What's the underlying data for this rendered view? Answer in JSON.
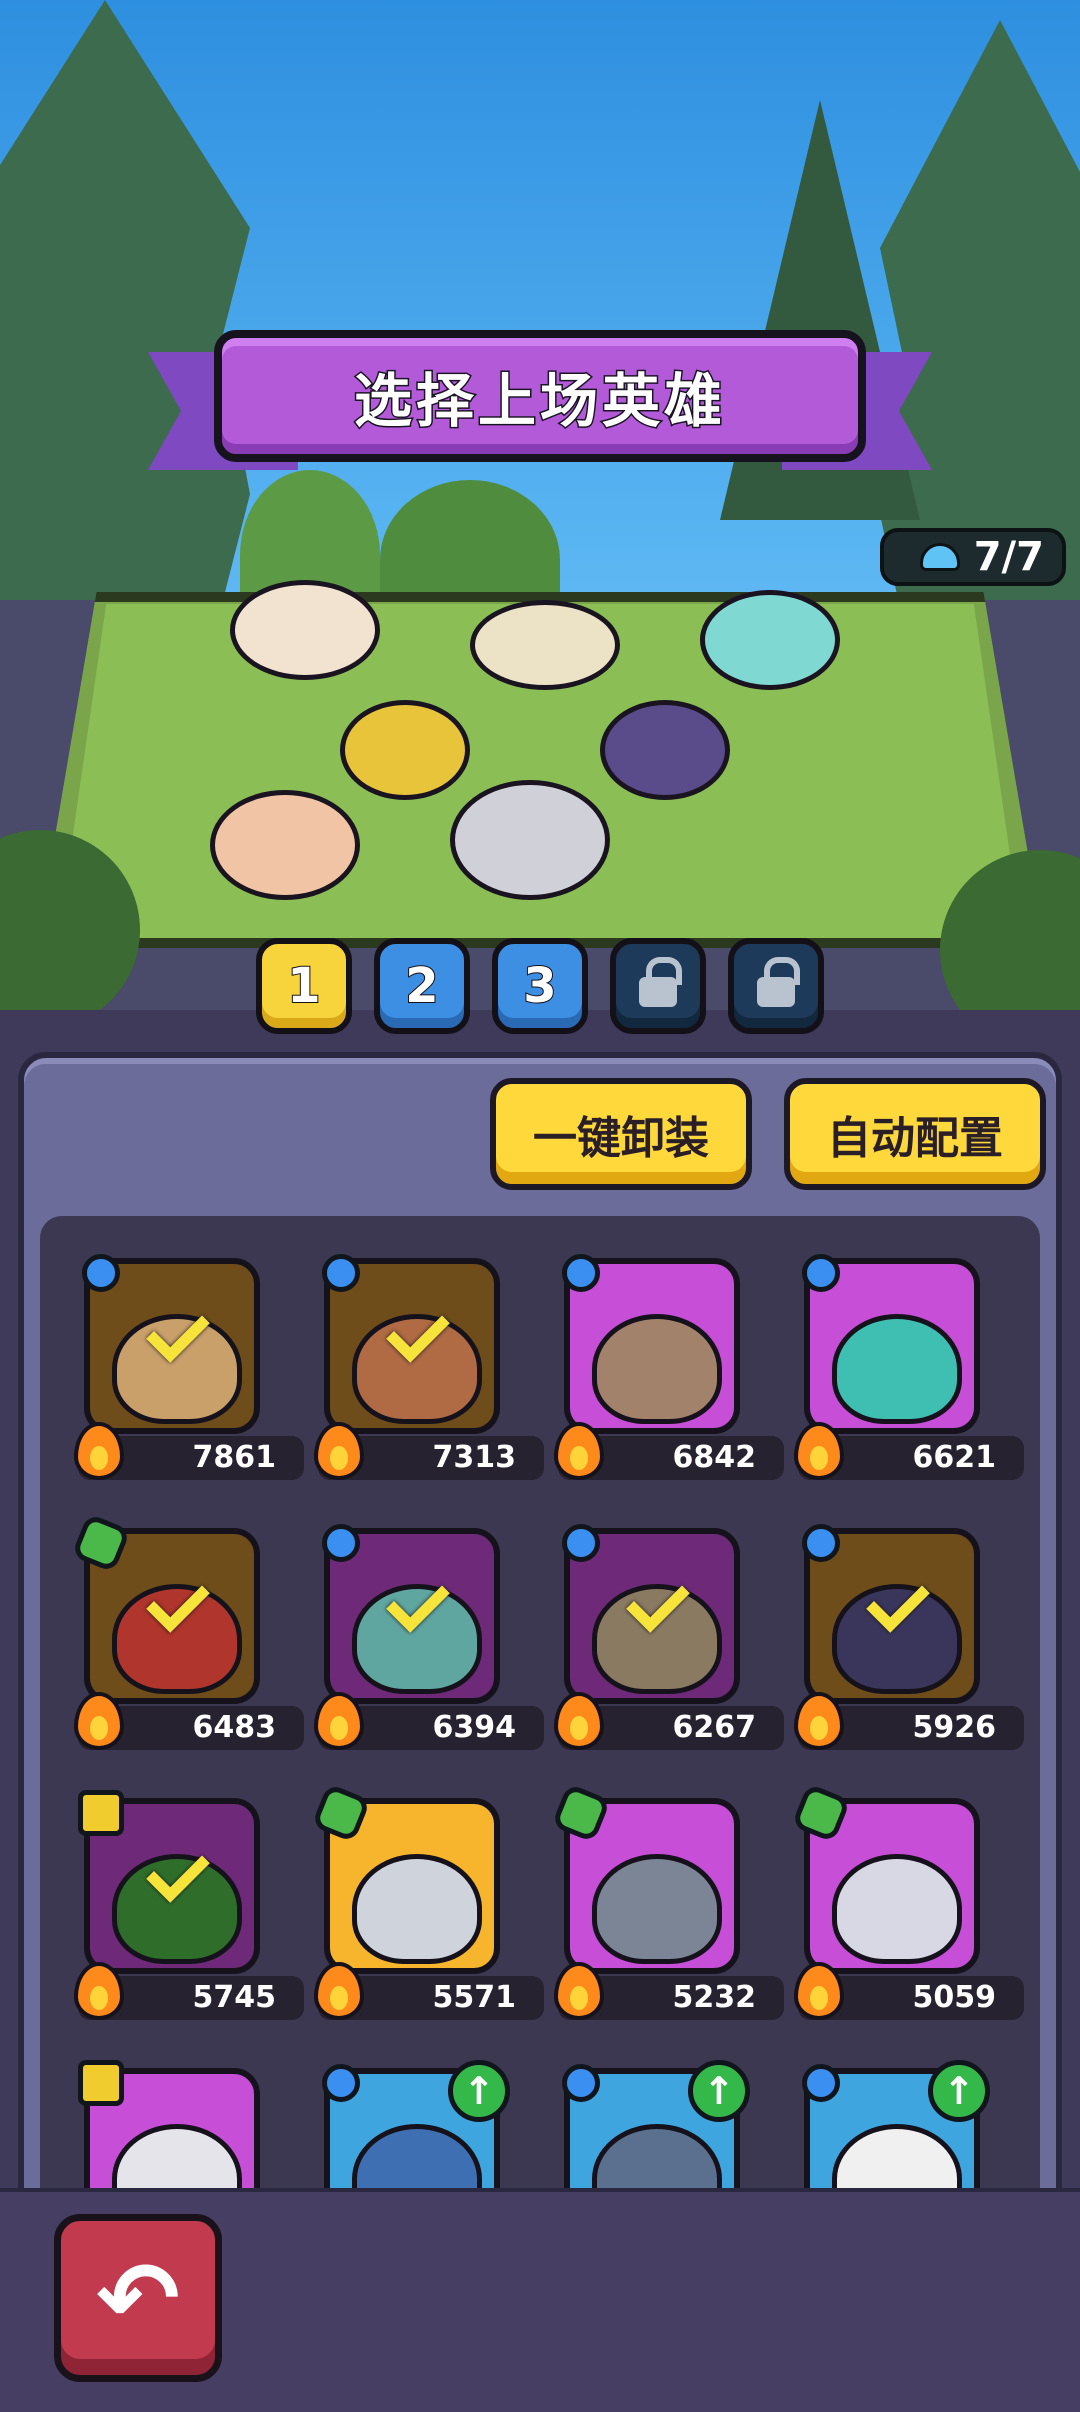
{
  "header": {
    "title": "选择上场英雄"
  },
  "capacity": {
    "value": "7/7"
  },
  "teams": [
    {
      "label": "1",
      "state": "active"
    },
    {
      "label": "2",
      "state": "normal"
    },
    {
      "label": "3",
      "state": "normal"
    },
    {
      "label": "",
      "state": "locked"
    },
    {
      "label": "",
      "state": "locked"
    }
  ],
  "actions": {
    "unequip_all": "一键卸装",
    "auto_config": "自动配置"
  },
  "heroes": [
    {
      "power": "7861",
      "badge": "blue",
      "frame": "gold",
      "selected": true
    },
    {
      "power": "7313",
      "badge": "blue",
      "frame": "gold",
      "selected": true
    },
    {
      "power": "6842",
      "badge": "blue",
      "frame": "purple",
      "selected": false
    },
    {
      "power": "6621",
      "badge": "blue",
      "frame": "purple",
      "selected": false
    },
    {
      "power": "6483",
      "badge": "green",
      "frame": "gold",
      "selected": true
    },
    {
      "power": "6394",
      "badge": "blue",
      "frame": "purple",
      "selected": true
    },
    {
      "power": "6267",
      "badge": "blue",
      "frame": "purple",
      "selected": true
    },
    {
      "power": "5926",
      "badge": "blue",
      "frame": "gold",
      "selected": true
    },
    {
      "power": "5745",
      "badge": "yellow",
      "frame": "purple",
      "selected": true
    },
    {
      "power": "5571",
      "badge": "green",
      "frame": "yellow",
      "selected": false
    },
    {
      "power": "5232",
      "badge": "green",
      "frame": "purple",
      "selected": false
    },
    {
      "power": "5059",
      "badge": "green",
      "frame": "purple",
      "selected": false
    },
    {
      "power": "",
      "badge": "yellow",
      "frame": "purple",
      "selected": false,
      "upgrade": false
    },
    {
      "power": "",
      "badge": "blue",
      "frame": "blue",
      "selected": false,
      "upgrade": true
    },
    {
      "power": "",
      "badge": "blue",
      "frame": "blue",
      "selected": false,
      "upgrade": true
    },
    {
      "power": "",
      "badge": "blue",
      "frame": "blue",
      "selected": false,
      "upgrade": true
    }
  ],
  "footer": {
    "back_icon": "back-arrow-icon"
  }
}
